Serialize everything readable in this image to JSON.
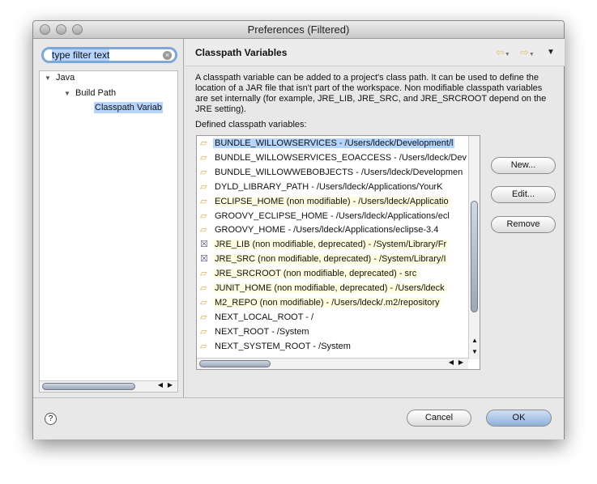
{
  "window": {
    "title": "Preferences (Filtered)"
  },
  "filter": {
    "value": "type filter text"
  },
  "tree": [
    {
      "label": "Java"
    },
    {
      "label": "Build Path"
    },
    {
      "label": "Classpath Variab"
    }
  ],
  "page": {
    "title": "Classpath Variables",
    "description": "A classpath variable can be added to a project's class path. It can be used to define the location of a JAR file that isn't part of the workspace. Non modifiable classpath variables are set internally (for example, JRE_LIB, JRE_SRC, and JRE_SRCROOT depend on the JRE setting).",
    "list_label": "Defined classpath variables:",
    "variables": [
      {
        "text": "BUNDLE_WILLOWSERVICES - /Users/ldeck/Development/l",
        "icon": "folder-icon",
        "state": "selected"
      },
      {
        "text": "BUNDLE_WILLOWSERVICES_EOACCESS - /Users/ldeck/Dev",
        "icon": "folder-icon",
        "state": "normal"
      },
      {
        "text": "BUNDLE_WILLOWWEBOBJECTS - /Users/ldeck/Developmen",
        "icon": "folder-icon",
        "state": "normal"
      },
      {
        "text": "DYLD_LIBRARY_PATH - /Users/ldeck/Applications/YourK",
        "icon": "folder-icon",
        "state": "normal"
      },
      {
        "text": "ECLIPSE_HOME (non modifiable) - /Users/ldeck/Applicatio",
        "icon": "folder-icon",
        "state": "nonmod"
      },
      {
        "text": "GROOVY_ECLIPSE_HOME - /Users/ldeck/Applications/ecl",
        "icon": "folder-icon",
        "state": "normal"
      },
      {
        "text": "GROOVY_HOME - /Users/ldeck/Applications/eclipse-3.4",
        "icon": "folder-icon",
        "state": "normal"
      },
      {
        "text": "JRE_LIB (non modifiable, deprecated) - /System/Library/Fr",
        "icon": "jar-deprecated-icon",
        "state": "nonmod"
      },
      {
        "text": "JRE_SRC (non modifiable, deprecated) - /System/Library/I",
        "icon": "jar-deprecated-icon",
        "state": "nonmod"
      },
      {
        "text": "JRE_SRCROOT (non modifiable, deprecated) - src",
        "icon": "folder-deprecated-icon",
        "state": "nonmod"
      },
      {
        "text": "JUNIT_HOME (non modifiable, deprecated) - /Users/ldeck",
        "icon": "folder-deprecated-icon",
        "state": "nonmod"
      },
      {
        "text": "M2_REPO (non modifiable) - /Users/ldeck/.m2/repository",
        "icon": "folder-icon",
        "state": "nonmod"
      },
      {
        "text": "NEXT_LOCAL_ROOT - /",
        "icon": "folder-icon",
        "state": "normal"
      },
      {
        "text": "NEXT_ROOT - /System",
        "icon": "folder-icon",
        "state": "normal"
      },
      {
        "text": "NEXT_SYSTEM_ROOT - /System",
        "icon": "folder-icon",
        "state": "normal"
      }
    ],
    "buttons": {
      "new": "New...",
      "edit": "Edit...",
      "remove": "Remove"
    }
  },
  "footer": {
    "cancel": "Cancel",
    "ok": "OK"
  }
}
